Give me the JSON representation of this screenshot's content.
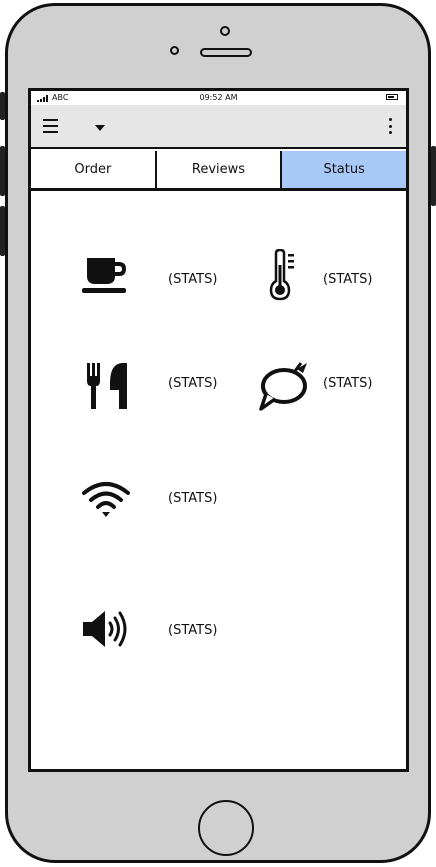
{
  "status_bar": {
    "carrier": "ABC",
    "time": "09:52 AM"
  },
  "tabs": [
    {
      "label": "Order",
      "active": false
    },
    {
      "label": "Reviews",
      "active": false
    },
    {
      "label": "Status",
      "active": true
    }
  ],
  "colors": {
    "active_tab": "#a8c8f8",
    "toolbar": "#e6e6e6",
    "phone_body": "#d0d0d0"
  },
  "stats": [
    {
      "icon": "coffee-cup-icon",
      "label": "(STATS)"
    },
    {
      "icon": "thermometer-icon",
      "label": "(STATS)"
    },
    {
      "icon": "fork-knife-icon",
      "label": "(STATS)"
    },
    {
      "icon": "speech-bubble-icon",
      "label": "(STATS)"
    },
    {
      "icon": "wifi-icon",
      "label": "(STATS)"
    },
    {
      "icon": "speaker-icon",
      "label": "(STATS)"
    }
  ]
}
